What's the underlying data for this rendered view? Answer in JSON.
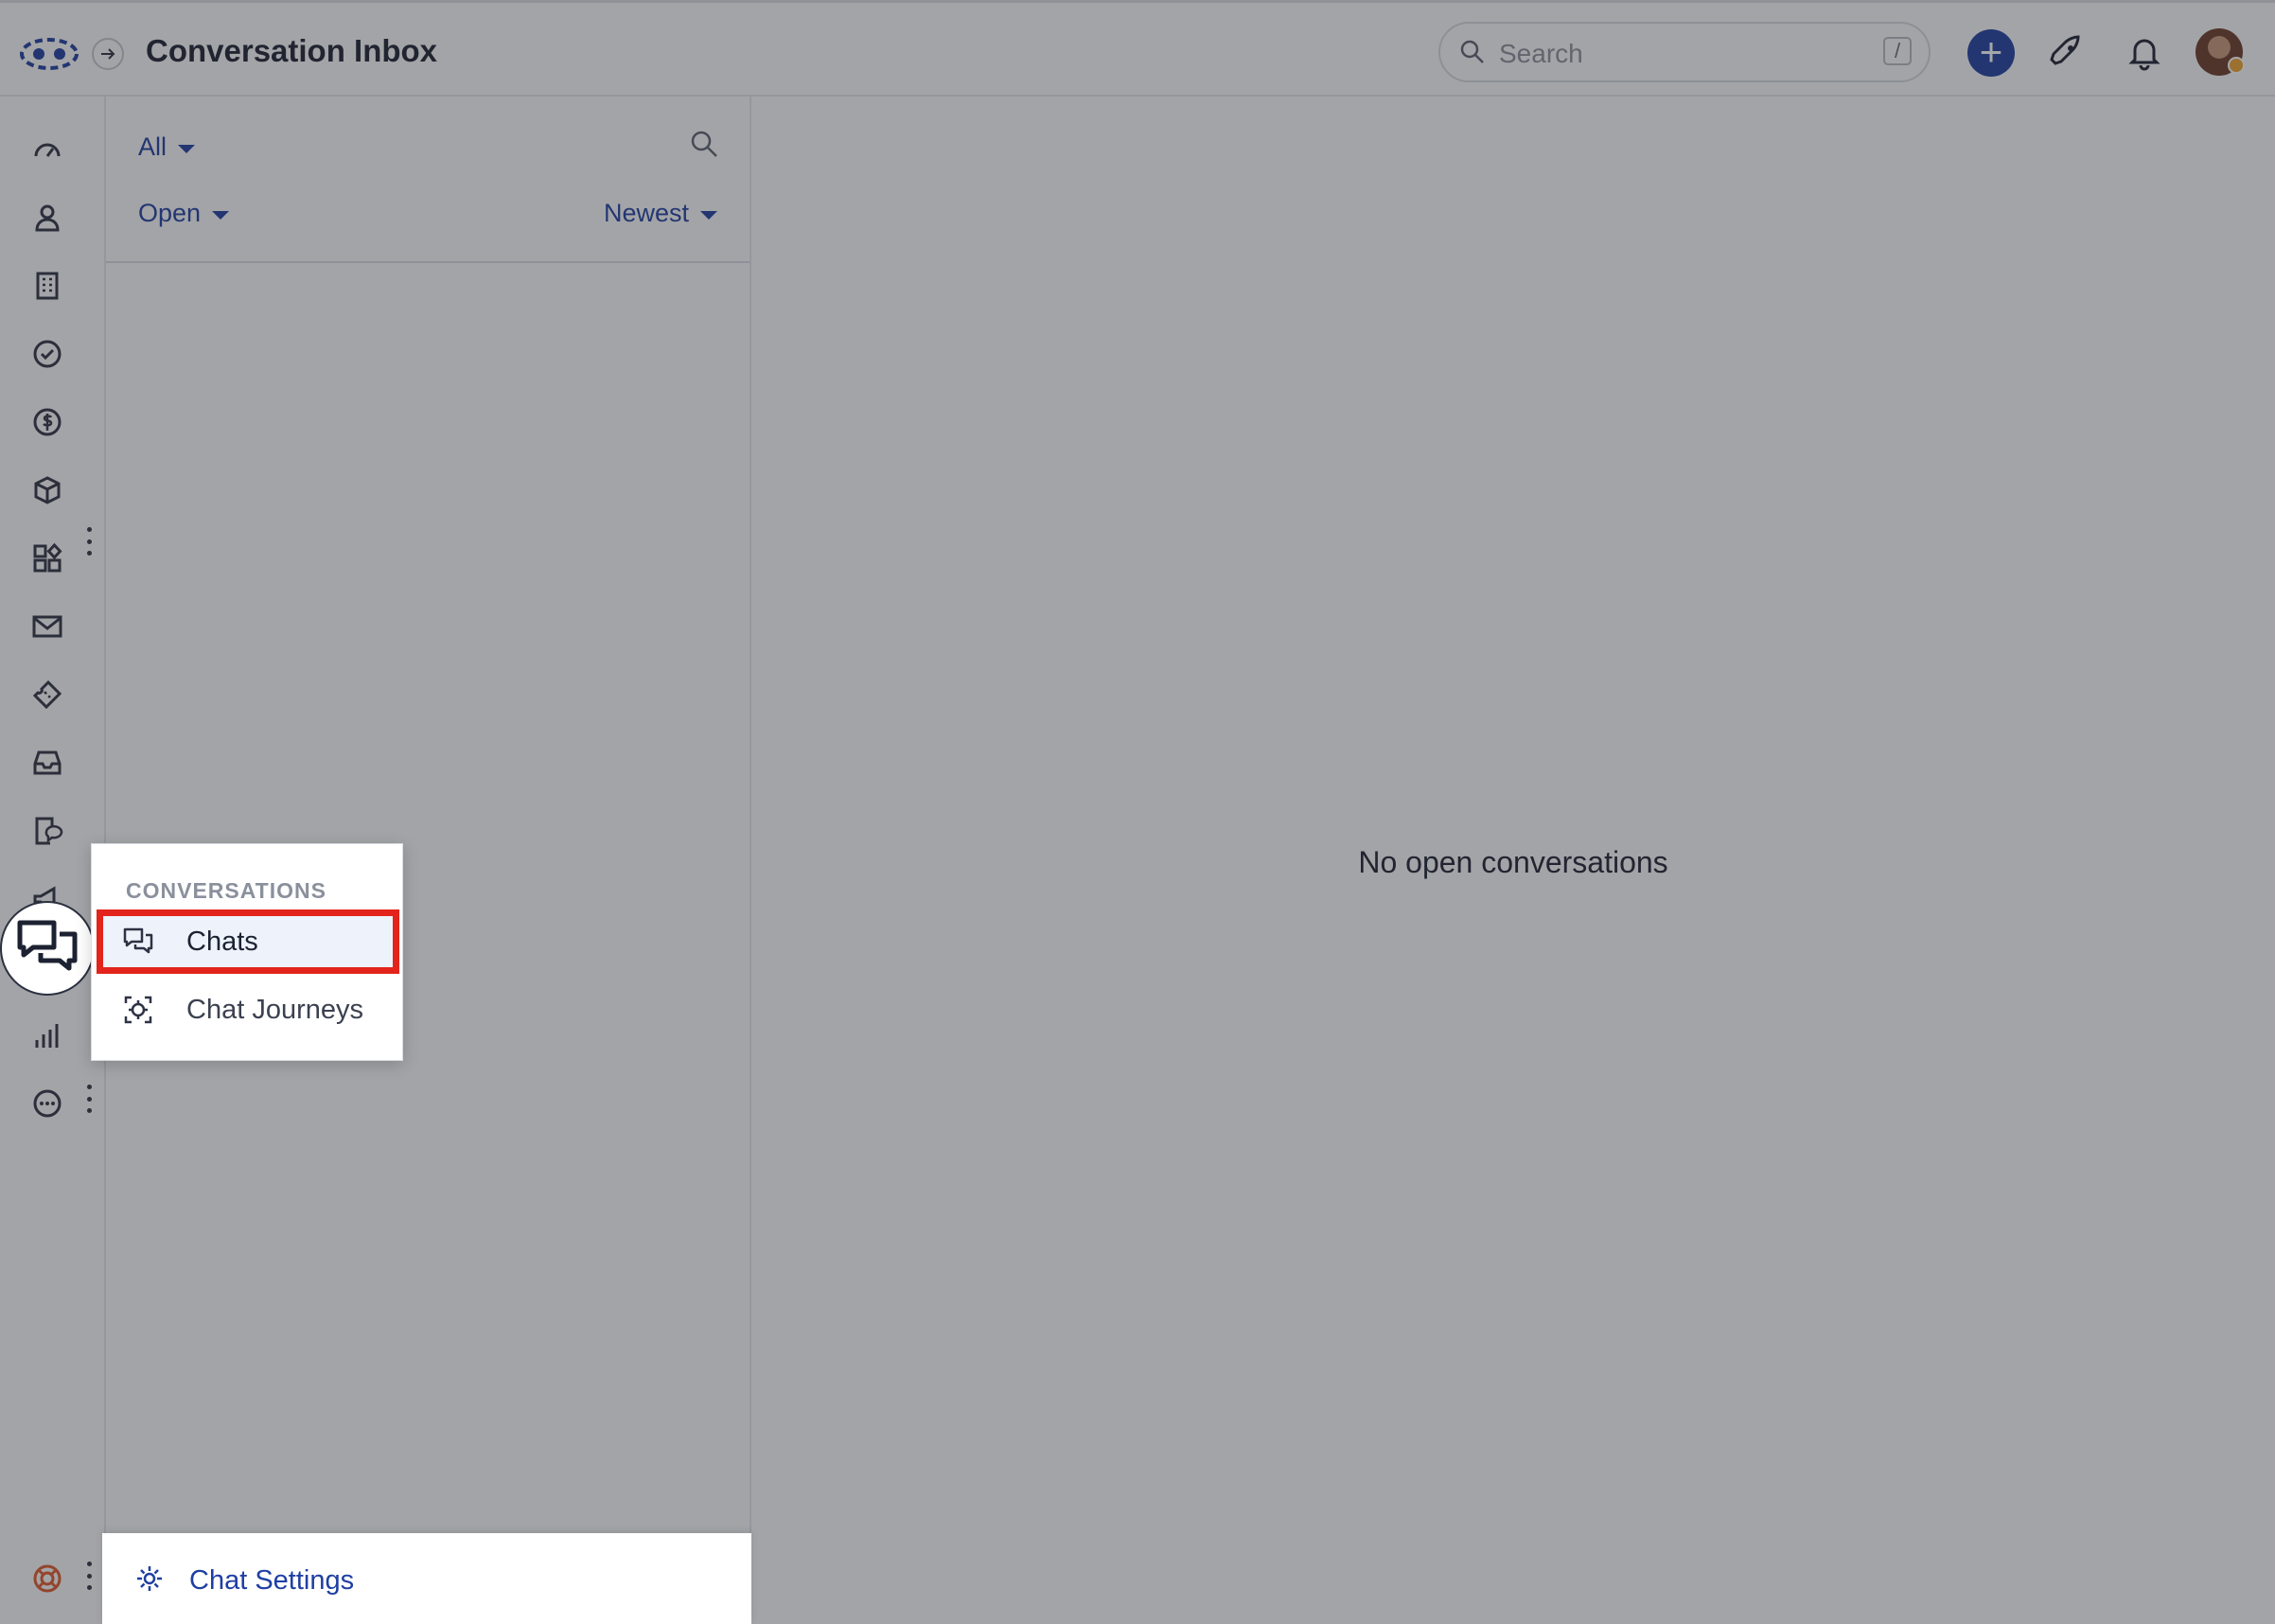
{
  "header": {
    "title": "Conversation Inbox",
    "search_placeholder": "Search",
    "search_shortcut": "/",
    "add_label": "+"
  },
  "sidebar": {
    "items": [
      {
        "name": "dashboard-icon"
      },
      {
        "name": "contacts-icon"
      },
      {
        "name": "companies-icon"
      },
      {
        "name": "tasks-icon"
      },
      {
        "name": "deals-icon"
      },
      {
        "name": "products-icon"
      },
      {
        "name": "apps-icon"
      },
      {
        "name": "email-icon"
      },
      {
        "name": "tickets-icon"
      },
      {
        "name": "inbox-icon"
      },
      {
        "name": "documents-icon"
      },
      {
        "name": "marketing-icon"
      },
      {
        "name": "conversations-icon"
      },
      {
        "name": "reports-icon"
      },
      {
        "name": "more-icon"
      },
      {
        "name": "help-icon"
      }
    ]
  },
  "list": {
    "filter_scope": "All",
    "filter_status": "Open",
    "sort": "Newest"
  },
  "main": {
    "empty_message": "No open conversations"
  },
  "menu": {
    "header": "CONVERSATIONS",
    "items": [
      {
        "label": "Chats",
        "icon": "chat-bubbles-icon",
        "active": true
      },
      {
        "label": "Chat Journeys",
        "icon": "chat-journeys-icon",
        "active": false
      }
    ]
  },
  "settings": {
    "label": "Chat Settings"
  },
  "colors": {
    "accent": "#1f3fa3",
    "highlight": "#e2241c",
    "help": "#e0582a"
  }
}
